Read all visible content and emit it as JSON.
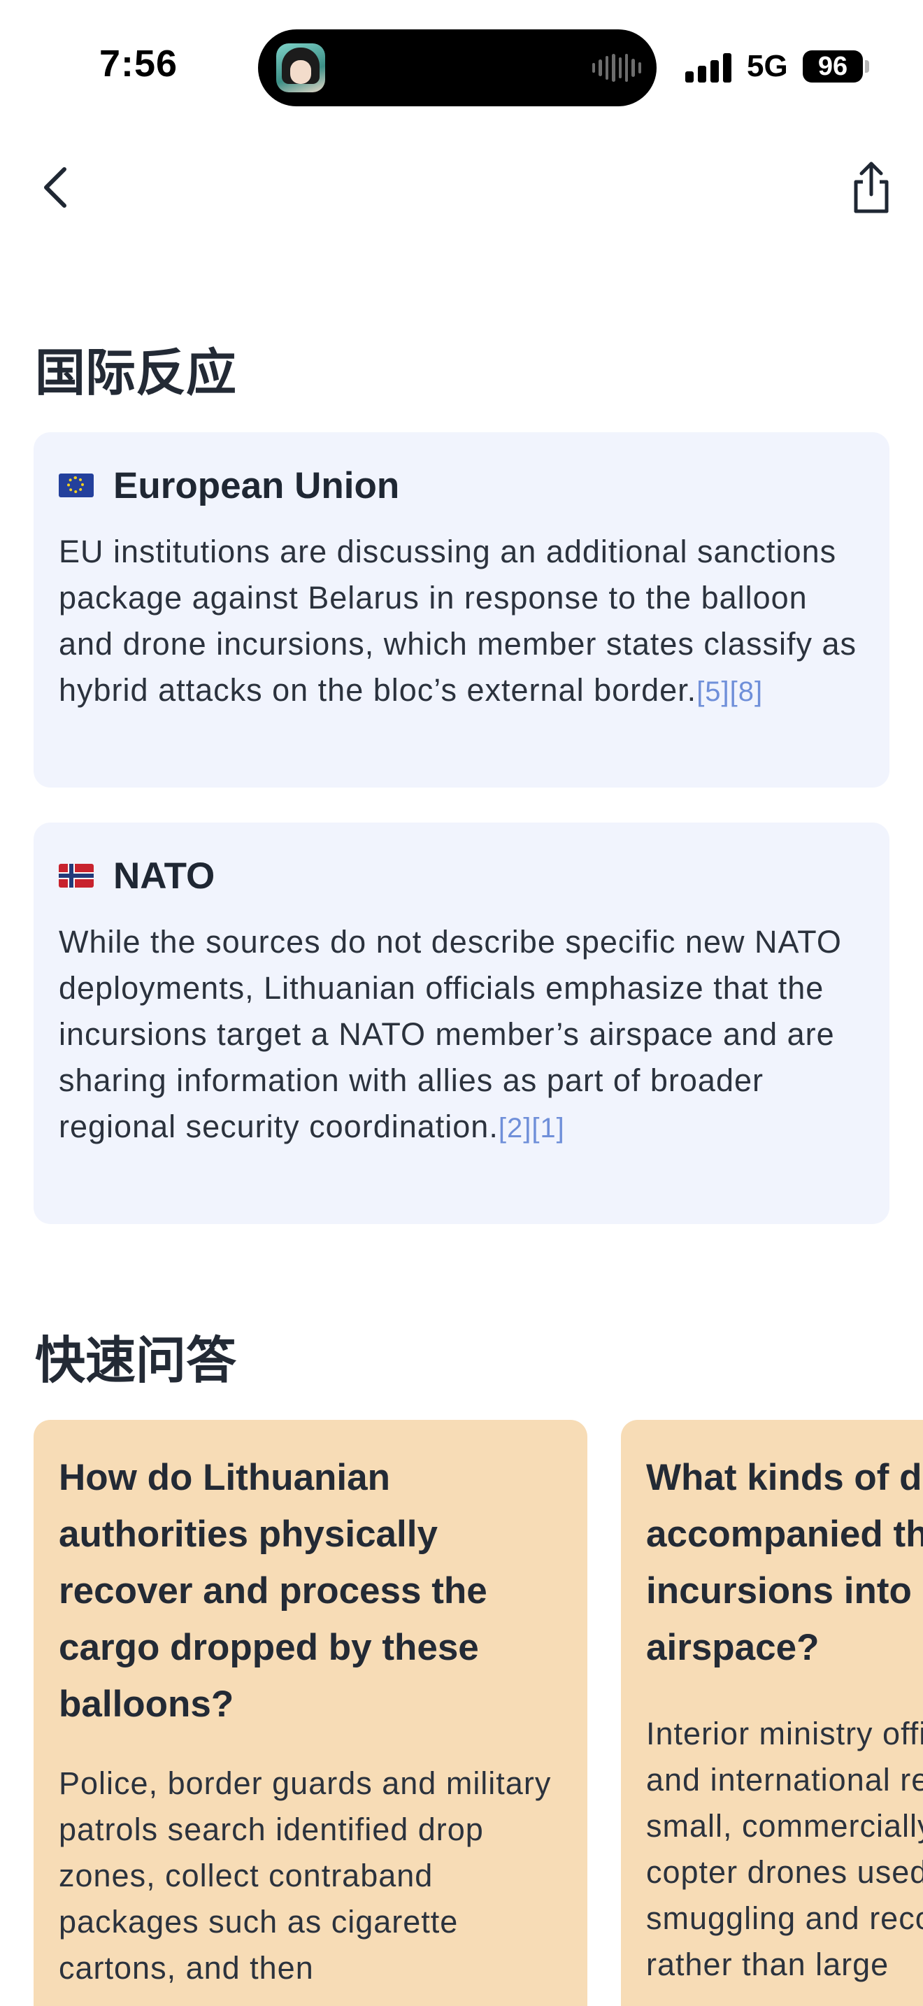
{
  "status_bar": {
    "time": "7:56",
    "network": "5G",
    "battery": "96"
  },
  "nav": {
    "back_icon": "chevron-left-icon",
    "share_icon": "share-icon"
  },
  "sections": {
    "reactions_title": "国际反应",
    "qa_title": "快速问答"
  },
  "reactions": [
    {
      "flag": "eu-flag-icon",
      "name": "European Union",
      "body": "EU institutions are discussing an additional sanctions package against Belarus in response to the balloon and drone incursions, which member states classify as hybrid attacks on the bloc’s external border.",
      "citations": "[5][8]"
    },
    {
      "flag": "norway-flag-icon",
      "name": "NATO",
      "body": "While the sources do not describe specific new NATO deployments, Lithuanian officials emphasize that the incursions target a NATO member’s airspace and are sharing information with allies as part of broader regional security coordination.",
      "citations": "[2][1]"
    }
  ],
  "qa": [
    {
      "question": "How do Lithuanian authorities physically recover and process the cargo dropped by these balloons?",
      "answer": "Police, border guards and military patrols search identified drop zones, collect contraband packages such as cigarette cartons, and then"
    },
    {
      "question": "What kinds of drones have accompanied the balloon incursions into Lithuanian airspace?",
      "answer": "Interior ministry officials and local and international reports mention small, commercially available quad-copter drones used for cigarette smuggling and reconnaissance rather than large"
    }
  ],
  "colors": {
    "card_bg": "#f1f4fd",
    "qa_bg": "#f7dcb6",
    "citation": "#6f8fd9"
  }
}
